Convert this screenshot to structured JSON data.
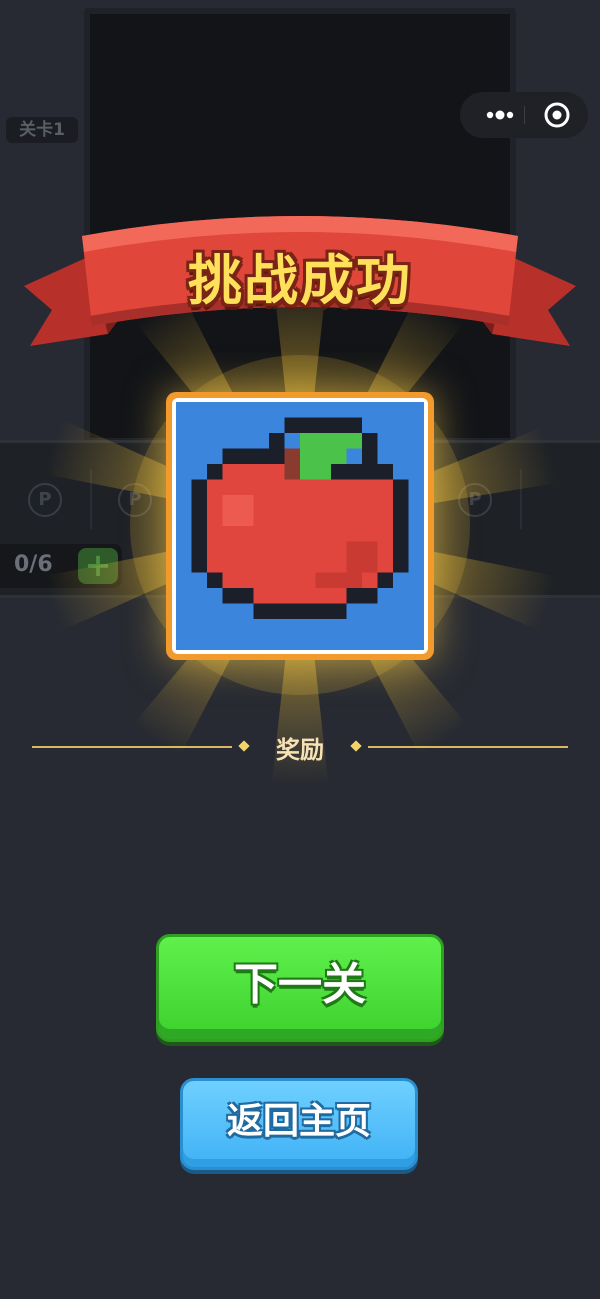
{
  "background": {
    "level_tag": "关卡1",
    "counter": "0/6",
    "counter_plus": "+",
    "coin_glyph": "P",
    "capsule_icons": [
      "more-dots-icon",
      "target-icon"
    ]
  },
  "dialog": {
    "title": "挑战成功",
    "reward_image": "pixel-apple-icon",
    "reward_label": "奖励",
    "next_button": "下一关",
    "home_button": "返回主页"
  },
  "colors": {
    "ribbon": "#e0463a",
    "title_text": "#ffe05a",
    "card_border": "#f39a2c",
    "next_button": "#4ee03c",
    "home_button": "#4fbcf8"
  }
}
